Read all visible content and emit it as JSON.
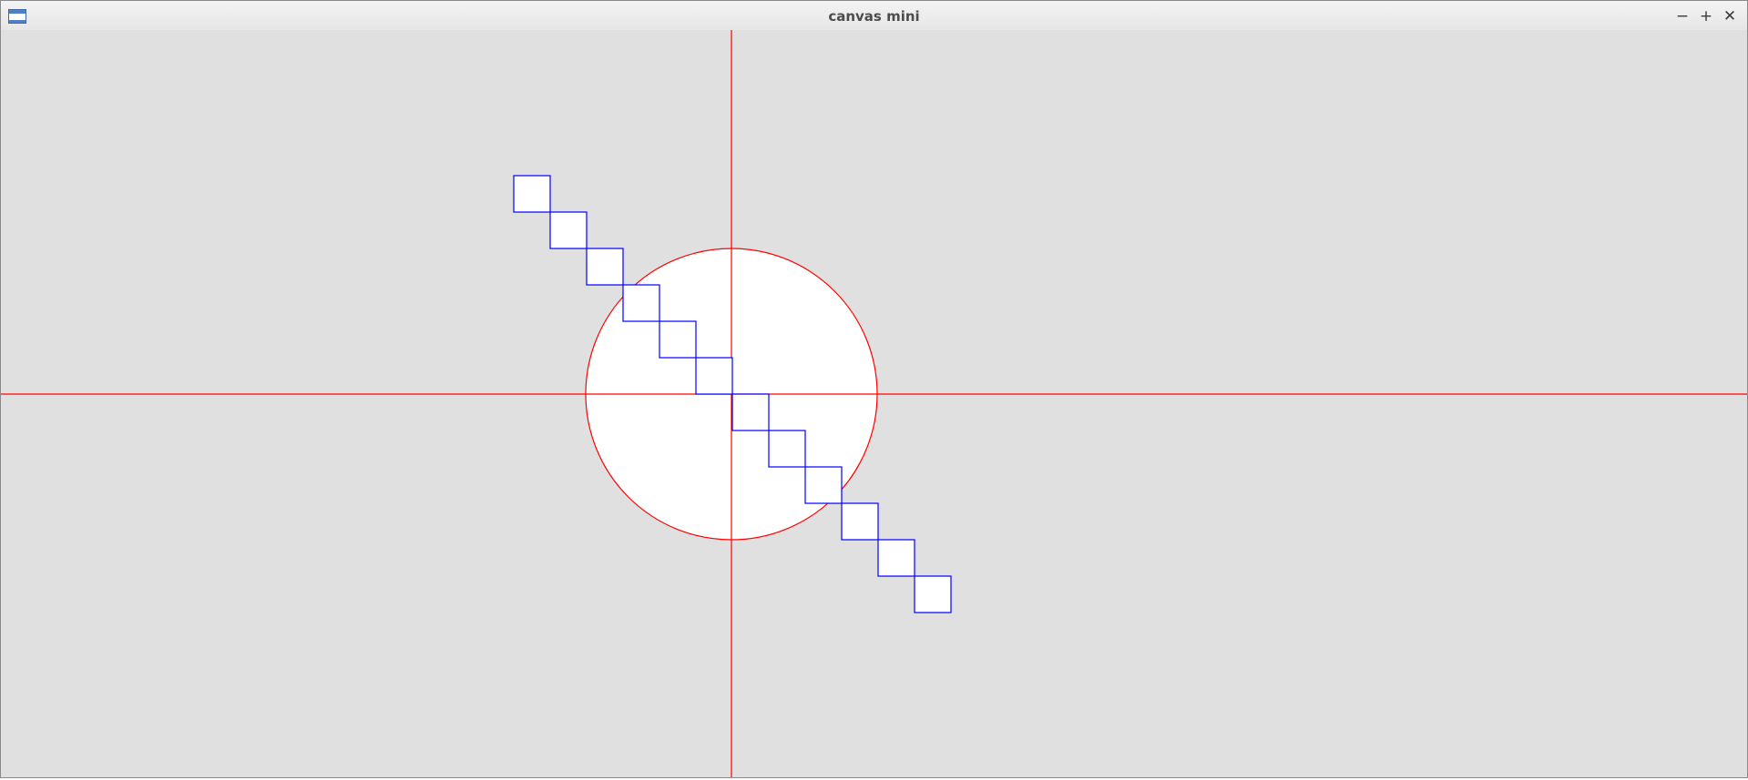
{
  "window": {
    "title": "canvas mini",
    "app_icon": "window-app-icon",
    "controls": {
      "minimize": {
        "label": "−",
        "icon": "minimize-icon"
      },
      "maximize": {
        "label": "+",
        "icon": "maximize-icon"
      },
      "close": {
        "label": "✕",
        "icon": "close-icon"
      }
    }
  },
  "canvas": {
    "background_color": "#e0e0e0",
    "axis_color": "#ff0000",
    "circle_fill": "#ffffff",
    "circle_stroke": "#ff0000",
    "square_stroke": "#0000ff",
    "square_fill": "#ffffff",
    "square_count": 12
  }
}
